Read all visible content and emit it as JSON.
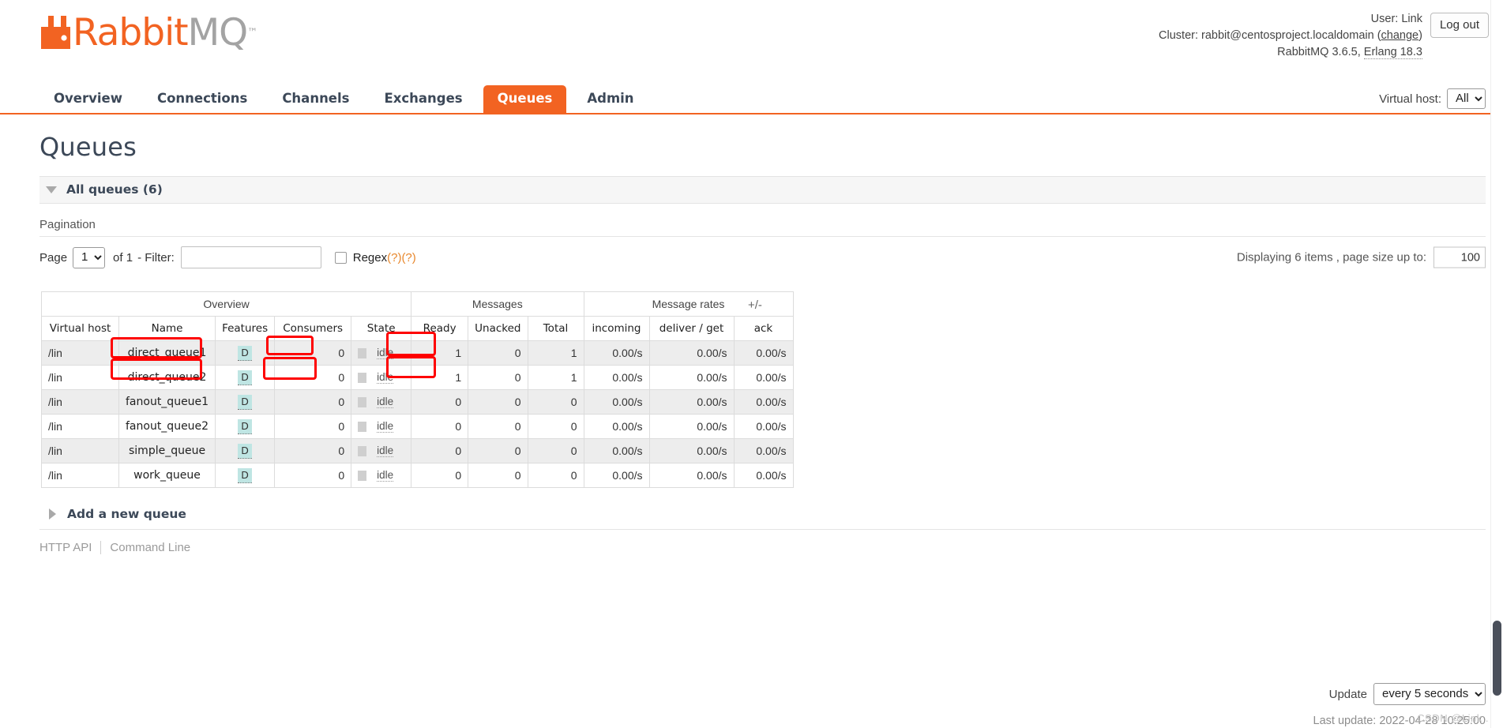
{
  "header": {
    "logo_rabbit": "Rabbit",
    "logo_mq": "MQ",
    "logo_tm": "™",
    "user_label": "User:",
    "user_name": "Link",
    "cluster_label": "Cluster:",
    "cluster_name": "rabbit@centosproject.localdomain",
    "cluster_change": "change",
    "version_line": "RabbitMQ 3.6.5,",
    "erlang": "Erlang 18.3",
    "logout_label": "Log out"
  },
  "nav": {
    "items": [
      {
        "label": "Overview",
        "active": false
      },
      {
        "label": "Connections",
        "active": false
      },
      {
        "label": "Channels",
        "active": false
      },
      {
        "label": "Exchanges",
        "active": false
      },
      {
        "label": "Queues",
        "active": true
      },
      {
        "label": "Admin",
        "active": false
      }
    ],
    "vhost_label": "Virtual host:",
    "vhost_value": "All"
  },
  "page": {
    "title": "Queues",
    "section_header": "All queues (6)",
    "pagination_label": "Pagination",
    "page_label": "Page",
    "page_value": "1",
    "of_label": "of 1",
    "filter_label": "- Filter:",
    "filter_value": "",
    "filter_placeholder": "",
    "regex_label": "Regex",
    "regex_help": "(?)(?)",
    "displaying_text": "Displaying 6 items , page size up to:",
    "page_size_value": "100",
    "plus_minus": "+/-",
    "add_queue_label": "Add a new queue"
  },
  "table": {
    "group_headers": [
      {
        "label": "Overview",
        "span": 5
      },
      {
        "label": "Messages",
        "span": 3
      },
      {
        "label": "Message rates",
        "span": 3
      }
    ],
    "columns": [
      "Virtual host",
      "Name",
      "Features",
      "Consumers",
      "State",
      "Ready",
      "Unacked",
      "Total",
      "incoming",
      "deliver / get",
      "ack"
    ],
    "rows": [
      {
        "vhost": "/lin",
        "name": "direct_queue1",
        "features": "D",
        "consumers": "0",
        "state": "idle",
        "ready": "1",
        "unacked": "0",
        "total": "1",
        "incoming": "0.00/s",
        "deliver_get": "0.00/s",
        "ack": "0.00/s"
      },
      {
        "vhost": "/lin",
        "name": "direct_queue2",
        "features": "D",
        "consumers": "0",
        "state": "idle",
        "ready": "1",
        "unacked": "0",
        "total": "1",
        "incoming": "0.00/s",
        "deliver_get": "0.00/s",
        "ack": "0.00/s"
      },
      {
        "vhost": "/lin",
        "name": "fanout_queue1",
        "features": "D",
        "consumers": "0",
        "state": "idle",
        "ready": "0",
        "unacked": "0",
        "total": "0",
        "incoming": "0.00/s",
        "deliver_get": "0.00/s",
        "ack": "0.00/s"
      },
      {
        "vhost": "/lin",
        "name": "fanout_queue2",
        "features": "D",
        "consumers": "0",
        "state": "idle",
        "ready": "0",
        "unacked": "0",
        "total": "0",
        "incoming": "0.00/s",
        "deliver_get": "0.00/s",
        "ack": "0.00/s"
      },
      {
        "vhost": "/lin",
        "name": "simple_queue",
        "features": "D",
        "consumers": "0",
        "state": "idle",
        "ready": "0",
        "unacked": "0",
        "total": "0",
        "incoming": "0.00/s",
        "deliver_get": "0.00/s",
        "ack": "0.00/s"
      },
      {
        "vhost": "/lin",
        "name": "work_queue",
        "features": "D",
        "consumers": "0",
        "state": "idle",
        "ready": "0",
        "unacked": "0",
        "total": "0",
        "incoming": "0.00/s",
        "deliver_get": "0.00/s",
        "ack": "0.00/s"
      }
    ]
  },
  "footer": {
    "http_api": "HTTP API",
    "command_line": "Command Line",
    "update_label": "Update",
    "update_value": "every 5 seconds",
    "last_update": "Last update: 2022-04-28 10:25:00",
    "watermark": "CSDN @Link ."
  },
  "colors": {
    "brand_orange": "#f26322",
    "annotation_red": "#fe0000",
    "feature_badge": "#bfe5e3"
  }
}
